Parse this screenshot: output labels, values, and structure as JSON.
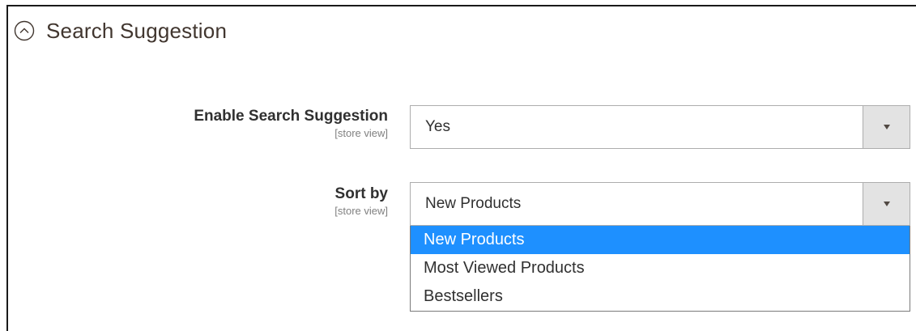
{
  "section": {
    "title": "Search Suggestion",
    "collapse_icon": "chevron-up-circle-icon"
  },
  "fields": {
    "enable": {
      "label": "Enable Search Suggestion",
      "scope": "[store view]",
      "value": "Yes"
    },
    "sort": {
      "label": "Sort by",
      "scope": "[store view]",
      "value": "New Products",
      "options": [
        "New Products",
        "Most Viewed Products",
        "Bestsellers"
      ],
      "highlighted_option": "New Products"
    }
  },
  "colors": {
    "highlight": "#1e90ff",
    "arrow_bg": "#e3e3e3",
    "border": "#adadad"
  }
}
